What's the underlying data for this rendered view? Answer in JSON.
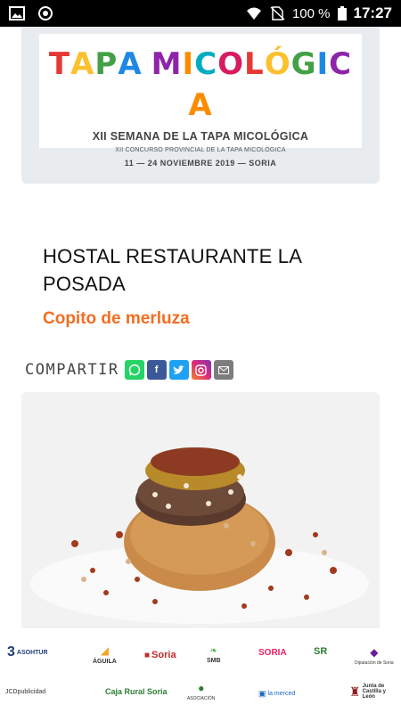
{
  "status_bar": {
    "battery": "100 %",
    "time": "17:27",
    "icons": [
      "image-icon",
      "record-icon",
      "wifi-icon",
      "no-sim-icon",
      "battery-icon"
    ]
  },
  "banner": {
    "title": "TAPA MICOLÓGICA",
    "subtitle": "XII SEMANA DE LA TAPA MICOLÓGICA",
    "contest": "XII CONCURSO PROVINCIAL DE LA TAPA MICOLÓGICA",
    "dates": "11 — 24 NOVIEMBRE 2019 — SORIA"
  },
  "restaurant": {
    "name": "HOSTAL RESTAURANTE LA POSADA",
    "dish": "Copito de merluza"
  },
  "share": {
    "label": "COMPARTIR",
    "buttons": [
      {
        "name": "whatsapp-icon",
        "glyph": "✆",
        "color": "#25d366"
      },
      {
        "name": "facebook-icon",
        "glyph": "f",
        "color": "#3b5998"
      },
      {
        "name": "twitter-icon",
        "glyph": "🐦",
        "color": "#1da1f2"
      },
      {
        "name": "instagram-icon",
        "glyph": "◎",
        "color": "#c13584"
      },
      {
        "name": "email-icon",
        "glyph": "✉",
        "color": "#7d7d7d"
      }
    ]
  },
  "sponsors": {
    "row1": [
      "ASOHTUR",
      "ÁGUILA",
      "Soria",
      "SMB",
      "SORIA",
      "SR",
      "Diputación de Soria"
    ],
    "row2": [
      "JCDpublicidad",
      "Caja Rural Soria",
      "ASOCIACIÓN",
      "la merced",
      "Junta de Castilla y León"
    ]
  },
  "colors": {
    "accent": "#f26d21",
    "banner_card": "#e8ecef"
  }
}
